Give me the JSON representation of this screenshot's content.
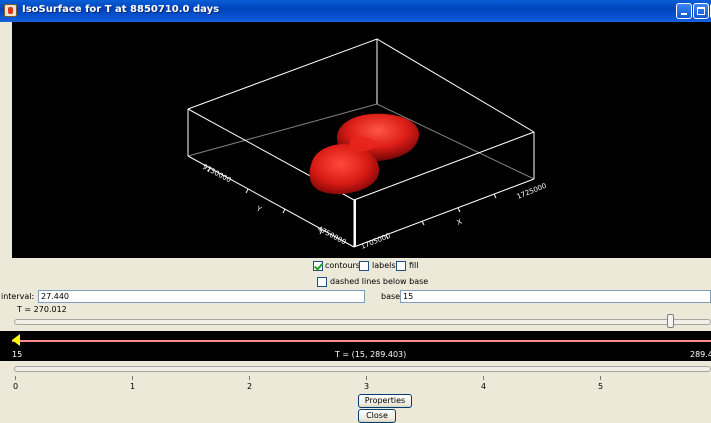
{
  "window": {
    "title": "IsoSurface for T at 8850710.0 days"
  },
  "viewport": {
    "axis_labels": {
      "y_left": "9750000",
      "y_bottom": "4750000",
      "y_letter": "Y",
      "x_left": "1705000",
      "x_right": "1725000",
      "x_letter": "X"
    },
    "surface_color": "#e0211b"
  },
  "options": {
    "contours": {
      "label": "contours",
      "checked": true
    },
    "labels": {
      "label": "labels",
      "checked": false
    },
    "fill": {
      "label": "fill",
      "checked": false
    },
    "dashed": {
      "label": "dashed lines below base",
      "checked": false
    }
  },
  "interval": {
    "label": "interval:",
    "value": "27.440"
  },
  "base": {
    "label": "base:",
    "value": "15"
  },
  "t_value": {
    "label": "T = 270.012",
    "slider_fraction": 0.942
  },
  "animation": {
    "min_label": "15",
    "range_label": "T = (15, 289.403)",
    "max_label": "289.4"
  },
  "timeline": {
    "ticks": [
      "0",
      "1",
      "2",
      "3",
      "4",
      "5"
    ]
  },
  "buttons": {
    "properties": "Properties",
    "close": "Close"
  }
}
